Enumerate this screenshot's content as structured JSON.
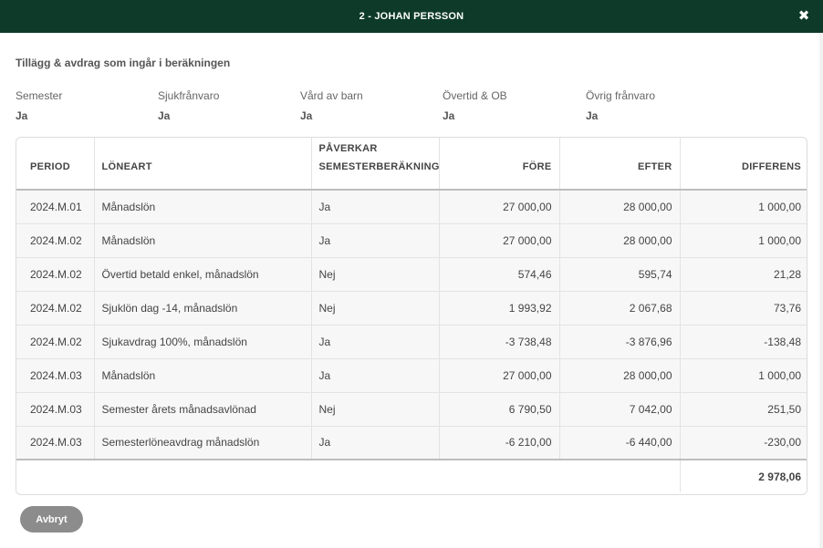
{
  "dialog": {
    "title": "2 - JOHAN PERSSON",
    "close_glyph": "✖"
  },
  "section": {
    "title": "Tillägg & avdrag som ingår i beräkningen"
  },
  "settings": [
    {
      "label": "Semester",
      "value": "Ja"
    },
    {
      "label": "Sjukfrånvaro",
      "value": "Ja"
    },
    {
      "label": "Vård av barn",
      "value": "Ja"
    },
    {
      "label": "Övertid & OB",
      "value": "Ja"
    },
    {
      "label": "Övrig frånvaro",
      "value": "Ja"
    }
  ],
  "table": {
    "headers": {
      "period": "PERIOD",
      "loneart": "LÖNEART",
      "paverkar_line1": "PÅVERKAR",
      "paverkar_line2": "SEMESTERBERÄKNING",
      "fore": "FÖRE",
      "efter": "EFTER",
      "differens": "DIFFERENS"
    },
    "rows": [
      {
        "period": "2024.M.01",
        "loneart": "Månadslön",
        "paverkar": "Ja",
        "fore": "27 000,00",
        "efter": "28 000,00",
        "differens": "1 000,00"
      },
      {
        "period": "2024.M.02",
        "loneart": "Månadslön",
        "paverkar": "Ja",
        "fore": "27 000,00",
        "efter": "28 000,00",
        "differens": "1 000,00"
      },
      {
        "period": "2024.M.02",
        "loneart": "Övertid betald enkel, månadslön",
        "paverkar": "Nej",
        "fore": "574,46",
        "efter": "595,74",
        "differens": "21,28"
      },
      {
        "period": "2024.M.02",
        "loneart": "Sjuklön dag -14, månadslön",
        "paverkar": "Nej",
        "fore": "1 993,92",
        "efter": "2 067,68",
        "differens": "73,76"
      },
      {
        "period": "2024.M.02",
        "loneart": "Sjukavdrag 100%, månadslön",
        "paverkar": "Ja",
        "fore": "-3 738,48",
        "efter": "-3 876,96",
        "differens": "-138,48"
      },
      {
        "period": "2024.M.03",
        "loneart": "Månadslön",
        "paverkar": "Ja",
        "fore": "27 000,00",
        "efter": "28 000,00",
        "differens": "1 000,00"
      },
      {
        "period": "2024.M.03",
        "loneart": "Semester årets månadsavlönad",
        "paverkar": "Nej",
        "fore": "6 790,50",
        "efter": "7 042,00",
        "differens": "251,50"
      },
      {
        "period": "2024.M.03",
        "loneart": "Semesterlöneavdrag månadslön",
        "paverkar": "Ja",
        "fore": "-6 210,00",
        "efter": "-6 440,00",
        "differens": "-230,00"
      }
    ],
    "total_differens": "2 978,06"
  },
  "footer": {
    "cancel_label": "Avbryt"
  }
}
